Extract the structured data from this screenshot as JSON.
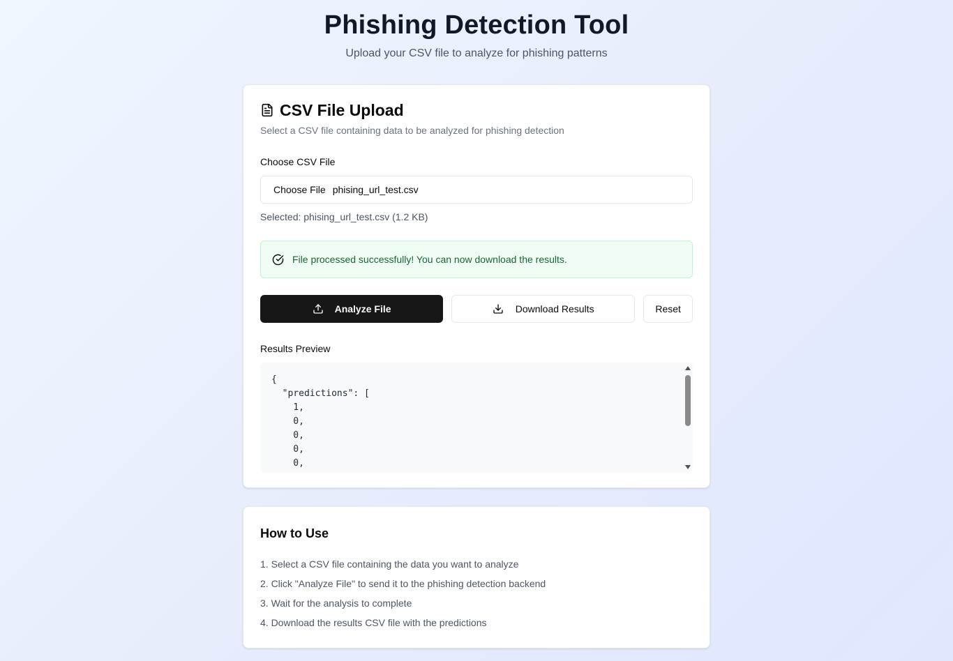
{
  "header": {
    "title": "Phishing Detection Tool",
    "subtitle": "Upload your CSV file to analyze for phishing patterns"
  },
  "upload_card": {
    "icon": "document-icon",
    "title": "CSV File Upload",
    "description": "Select a CSV file containing data to be analyzed for phishing detection",
    "file_label": "Choose CSV File",
    "choose_button_label": "Choose File",
    "file_name": "phising_url_test.csv",
    "selected_text": "Selected: phising_url_test.csv (1.2 KB)",
    "alert_text": "File processed successfully! You can now download the results.",
    "alert_icon": "check-circle-icon",
    "buttons": {
      "analyze": "Analyze File",
      "download": "Download Results",
      "reset": "Reset"
    },
    "results_label": "Results Preview",
    "results_text": "{\n  \"predictions\": [\n    1,\n    0,\n    0,\n    0,\n    0,"
  },
  "howto_card": {
    "title": "How to Use",
    "steps": [
      "1. Select a CSV file containing the data you want to analyze",
      "2. Click \"Analyze File\" to send it to the phishing detection backend",
      "3. Wait for the analysis to complete",
      "4. Download the results CSV file with the predictions"
    ]
  },
  "colors": {
    "primary_button": "#171717",
    "success_bg": "#f0fdf4",
    "success_text": "#166534",
    "success_border": "#bbf7d0"
  }
}
